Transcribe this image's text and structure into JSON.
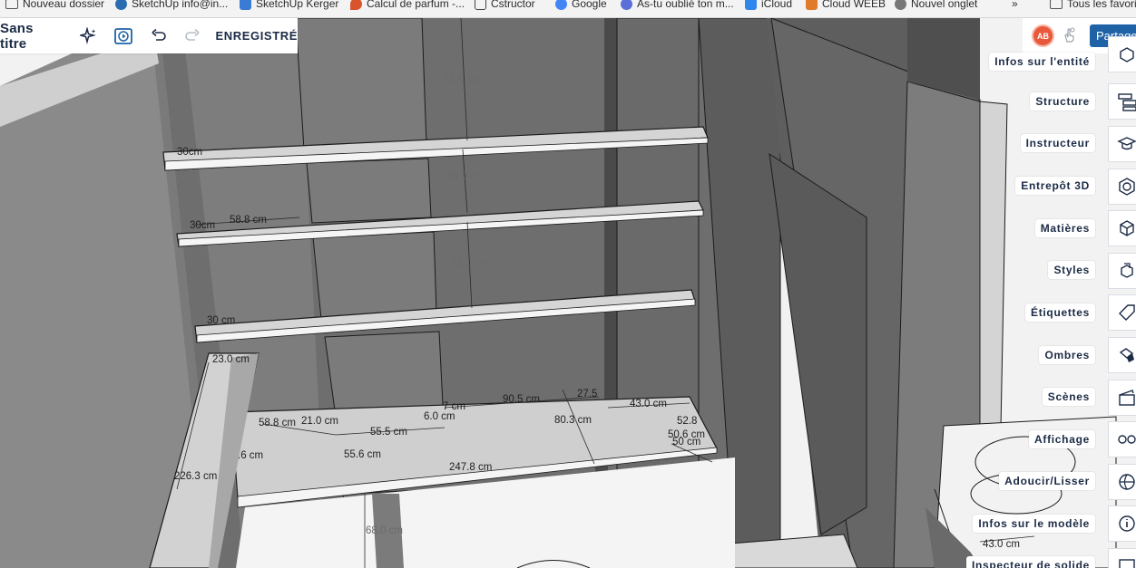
{
  "bookmarks": [
    {
      "label": "Nouveau dossier",
      "icon": "folder-icon"
    },
    {
      "label": "SketchUp info@in...",
      "icon": "sketchup-icon"
    },
    {
      "label": "SketchUp Kerger",
      "icon": "sketchup-icon"
    },
    {
      "label": "Calcul de parfum -...",
      "icon": "flame-icon"
    },
    {
      "label": "Cstructor",
      "icon": "page-icon"
    },
    {
      "label": "Google",
      "icon": "google-icon"
    },
    {
      "label": "As-tu oublié ton m...",
      "icon": "user-icon"
    },
    {
      "label": "iCloud",
      "icon": "cloud-icon"
    },
    {
      "label": "Cloud WEEB",
      "icon": "cloud-icon"
    },
    {
      "label": "Nouvel onglet",
      "icon": "globe-icon"
    },
    {
      "label": "Tous les favoris",
      "icon": "folder-icon"
    }
  ],
  "toolbar": {
    "title": "Sans titre",
    "save_status": "ENREGISTRÉ",
    "avatar_initials": "AB",
    "share_label": "Partage"
  },
  "panels": [
    {
      "label": "Infos sur l'entité",
      "icon": "entity-info-icon"
    },
    {
      "label": "Structure",
      "icon": "outliner-icon"
    },
    {
      "label": "Instructeur",
      "icon": "instructor-icon"
    },
    {
      "label": "Entrepôt 3D",
      "icon": "warehouse-icon"
    },
    {
      "label": "Matières",
      "icon": "materials-icon"
    },
    {
      "label": "Styles",
      "icon": "styles-icon"
    },
    {
      "label": "Étiquettes",
      "icon": "tags-icon"
    },
    {
      "label": "Ombres",
      "icon": "shadows-icon"
    },
    {
      "label": "Scènes",
      "icon": "scenes-icon"
    },
    {
      "label": "Affichage",
      "icon": "display-icon"
    },
    {
      "label": "Adoucir/Lisser",
      "icon": "soften-icon"
    },
    {
      "label": "Infos sur le modèle",
      "icon": "model-info-icon"
    },
    {
      "label": "Inspecteur de solide",
      "icon": "solid-inspector-icon"
    }
  ],
  "dimensions": [
    "55.9 cm",
    "30cm",
    "35.0 cm",
    "30cm",
    "58.8 cm",
    "46.1 cm",
    "30 cm",
    "23.0 cm",
    "90.5 cm",
    "27.5",
    "43.0 cm",
    "7 cm",
    "58.8 cm",
    "21.0 cm",
    "6.0 cm",
    "55.5 cm",
    "80.3 cm",
    "52.8",
    "50.6 cm",
    "50 cm",
    ".6 cm",
    "55.6 cm",
    "247.8 cm",
    "226.3 cm",
    "68.0 cm",
    "43.0 cm"
  ],
  "colors": {
    "toolbar_text": "#1b2a45",
    "share_button": "#1f63a6",
    "avatar": "#e8583a",
    "wall_dark": "#6a6a6a",
    "shelf_top": "#d6d6d6"
  }
}
